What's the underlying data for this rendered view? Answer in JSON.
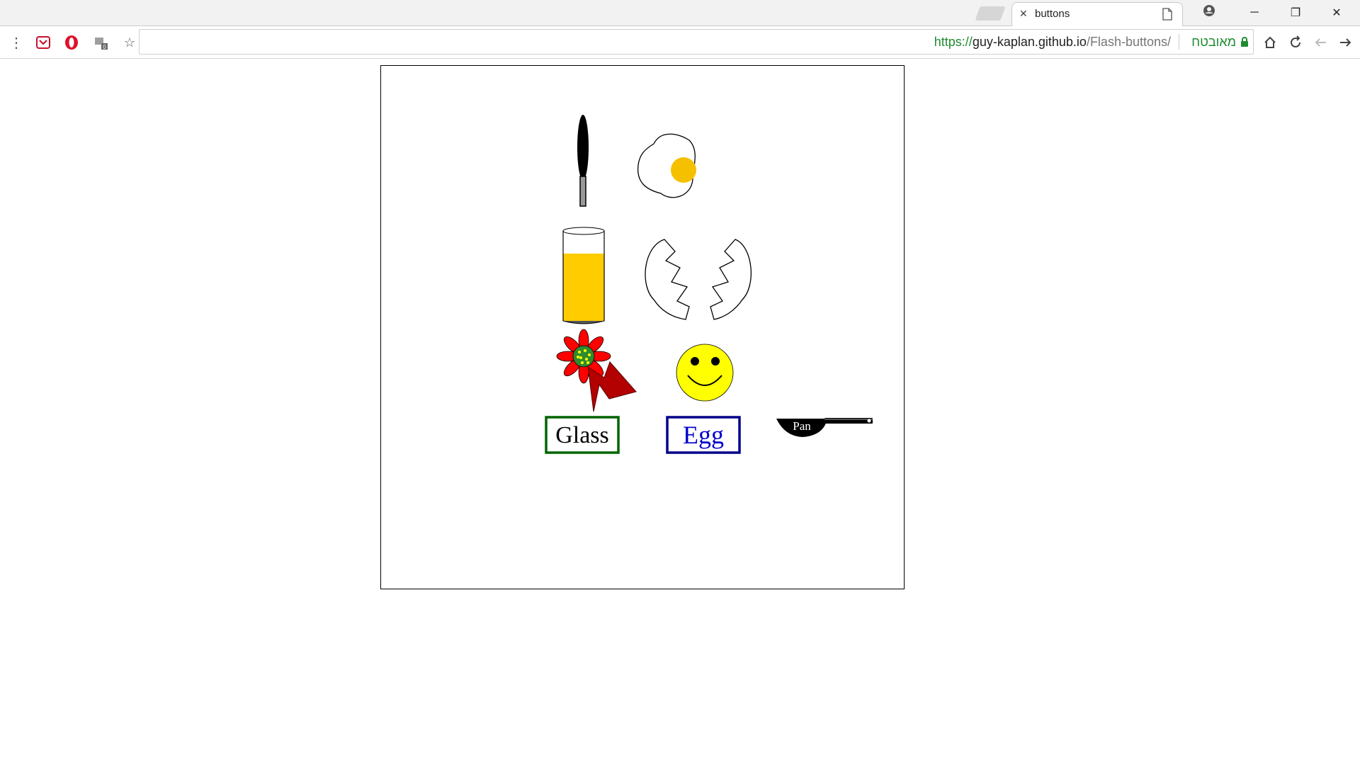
{
  "tab": {
    "title": "buttons"
  },
  "address_bar": {
    "url_scheme": "https://",
    "url_host": "guy-kaplan.github.io",
    "url_path": "/Flash-buttons/",
    "security_label": "מאובטח"
  },
  "stage": {
    "buttons": {
      "glass_label": "Glass",
      "egg_label": "Egg",
      "pan_label": "Pan"
    }
  },
  "colors": {
    "security_green": "#1e8c2f",
    "glass_border": "#006400",
    "egg_border": "#00008b",
    "egg_text": "#0000cc",
    "yolk": "#f5c000",
    "juice": "#ffcc00",
    "smiley": "#ffff00",
    "flower": "#ff0000",
    "arrow": "#aa0000"
  },
  "icons": [
    "menu-dots-icon",
    "pocket-icon",
    "opera-icon",
    "extension-icon",
    "star-icon",
    "home-icon",
    "reload-icon",
    "back-icon",
    "forward-icon",
    "lock-icon",
    "profile-icon",
    "minimize-icon",
    "restore-icon",
    "close-icon",
    "tab-close-icon",
    "page-icon"
  ]
}
